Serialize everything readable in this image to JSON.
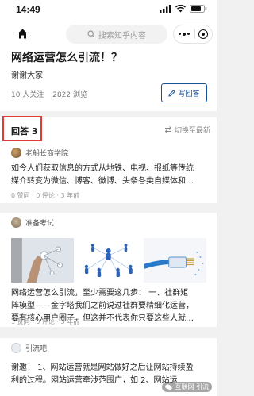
{
  "status_bar": {
    "time": "14:49"
  },
  "search": {
    "placeholder": "搜索知乎内容"
  },
  "question": {
    "title": "网络运营怎么引流！？",
    "description": "谢谢大家",
    "followers": "10 人关注",
    "views": "2822 浏览",
    "write_answer_label": "写回答"
  },
  "answers_header": {
    "label": "回答 3",
    "switch_label": "切换至最新"
  },
  "answers": [
    {
      "author": "老船长商学院",
      "excerpt_line1": "如今人们获取信息的方式从地铁、电视、报纸等传统",
      "excerpt_line2": "媒介转变为微信、博客、微博、头条各类自媒体和…",
      "meta": "0 赞同 · 0 评论 · 3 年前"
    },
    {
      "author": "准备考试",
      "excerpt_line1": "网络运营怎么引流，至少需要这几步： 一、社群矩",
      "excerpt_line2": "阵模型——金字塔我们之前说过社群要精细化运营，",
      "excerpt_line3": "要有核心用户圈子，但这并不代表你只要这些人就…",
      "meta": "1 赞同 · 0 评论 · 3 年前"
    },
    {
      "author": "引流吧",
      "excerpt_line1": "谢邀！ 1、网站运营就是网站做好之后让网站持续盈",
      "excerpt_line2": "利的过程。网站运营牵涉范围广，如 2、网站运"
    }
  ],
  "watermark": "互联网 引流",
  "colors": {
    "accent": "#175199",
    "highlight": "#e23a36",
    "background": "#f1f1f1"
  }
}
